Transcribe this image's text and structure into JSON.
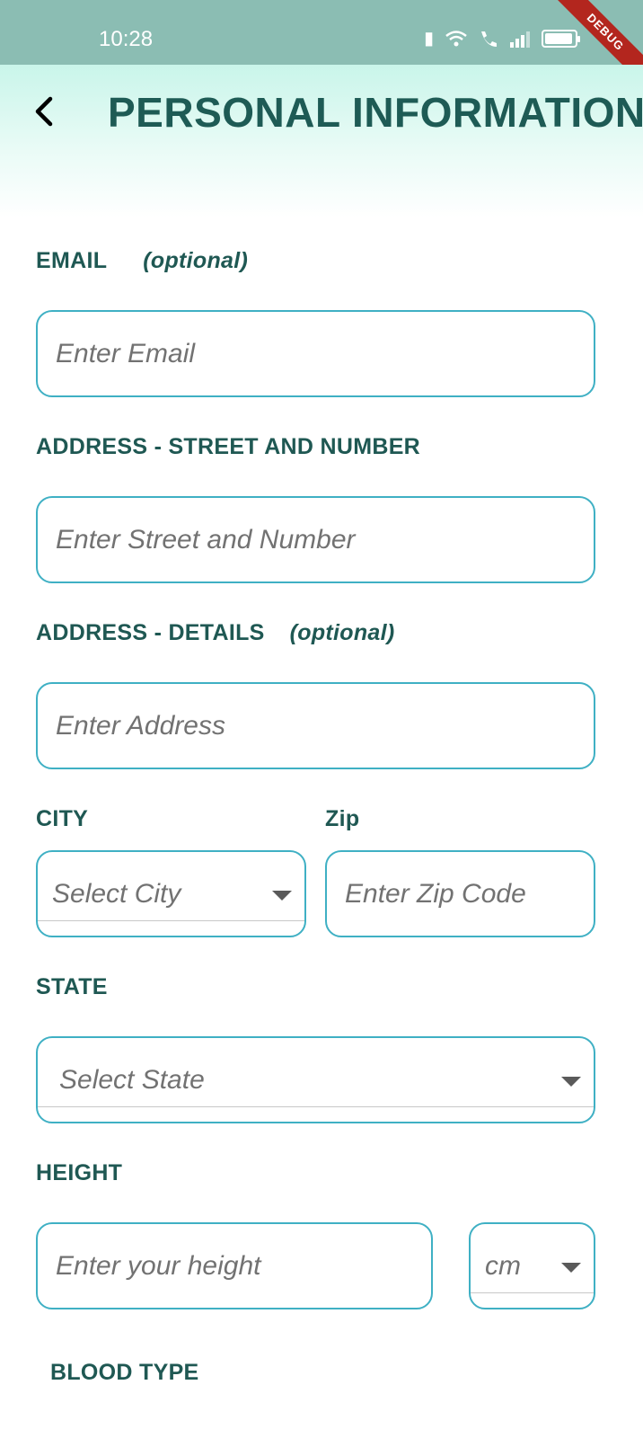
{
  "status_bar": {
    "time": "10:28",
    "icons": [
      "vibrate-icon",
      "wifi-icon",
      "wifi-call-icon",
      "signal-icon",
      "battery-icon"
    ],
    "debug_label": "DEBUG"
  },
  "header": {
    "title": "PERSONAL INFORMATION",
    "back_icon": "chevron-left-icon"
  },
  "form": {
    "email": {
      "label": "EMAIL",
      "optional": "(optional)",
      "placeholder": "Enter Email"
    },
    "street": {
      "label": "ADDRESS - STREET AND NUMBER",
      "placeholder": "Enter Street and Number"
    },
    "details": {
      "label": "ADDRESS - DETAILS",
      "optional": "(optional)",
      "placeholder": "Enter Address"
    },
    "city": {
      "label": "CITY",
      "placeholder": "Select City"
    },
    "zip": {
      "label": "Zip",
      "placeholder": "Enter Zip Code"
    },
    "state": {
      "label": "STATE",
      "placeholder": "Select State"
    },
    "height": {
      "label": "HEIGHT",
      "placeholder": "Enter your height",
      "unit": "cm"
    },
    "blood_type": {
      "label": "BLOOD TYPE"
    }
  },
  "colors": {
    "status_bar": "#8bbdb3",
    "header_gradient_top": "#c9f5ea",
    "title": "#1e5b55",
    "field_border": "#3fb0c4",
    "debug_ribbon": "#b3261e"
  }
}
